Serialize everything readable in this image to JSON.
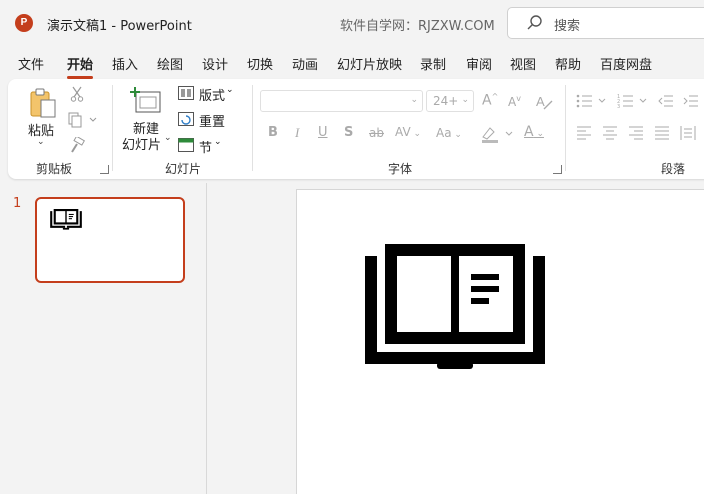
{
  "titlebar": {
    "logo_letter": "P",
    "doc_title": "演示文稿1  -  PowerPoint",
    "watermark": "软件自学网：RJZXW.COM",
    "search_placeholder": "搜索"
  },
  "menu": [
    {
      "label": "文件",
      "active": false
    },
    {
      "label": "开始",
      "active": true
    },
    {
      "label": "插入",
      "active": false
    },
    {
      "label": "绘图",
      "active": false
    },
    {
      "label": "设计",
      "active": false
    },
    {
      "label": "切换",
      "active": false
    },
    {
      "label": "动画",
      "active": false
    },
    {
      "label": "幻灯片放映",
      "active": false
    },
    {
      "label": "录制",
      "active": false
    },
    {
      "label": "审阅",
      "active": false
    },
    {
      "label": "视图",
      "active": false
    },
    {
      "label": "帮助",
      "active": false
    },
    {
      "label": "百度网盘",
      "active": false
    }
  ],
  "ribbon": {
    "clipboard": {
      "paste_label": "粘贴",
      "group_label": "剪贴板"
    },
    "slides": {
      "new_slide_line1": "新建",
      "new_slide_line2": "幻灯片",
      "layout_label": "版式",
      "reset_label": "重置",
      "section_label": "节",
      "group_label": "幻灯片"
    },
    "font": {
      "font_name": "",
      "font_size": "24+",
      "group_label": "字体",
      "bold": "B",
      "italic": "I",
      "underline": "U",
      "shadow": "S",
      "strike": "ab",
      "spacing": "AV",
      "case": "Aa",
      "grow": "A",
      "shrink": "A",
      "font_color": "A"
    },
    "paragraph": {
      "group_label": "段落"
    }
  },
  "slides_pane": {
    "slide_number": "1"
  },
  "slide": {
    "icon": "open-book-icon"
  },
  "colors": {
    "accent": "#c43e1c",
    "ribbon_bg": "#ffffff",
    "window_bg": "#f3f3f3"
  }
}
